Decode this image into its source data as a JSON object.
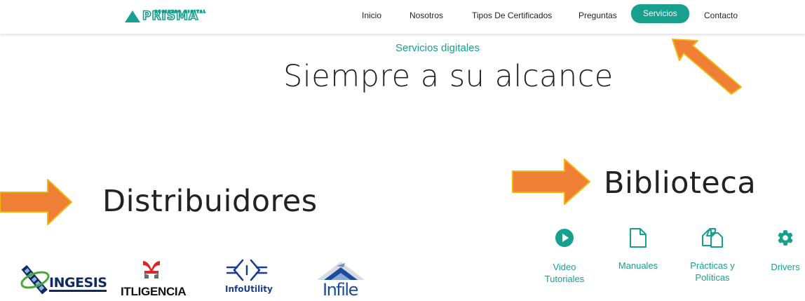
{
  "nav": {
    "logo_subtitle": "REGISTRO DIGITAL",
    "logo_text": "PRISMA",
    "items": [
      {
        "label": "Inicio"
      },
      {
        "label": "Nosotros"
      },
      {
        "label": "Tipos De Certificados"
      },
      {
        "label": "Preguntas"
      },
      {
        "label": "Servicios",
        "active": true
      },
      {
        "label": "Contacto"
      }
    ]
  },
  "hero": {
    "eyebrow": "Servicios digitales",
    "title": "Siempre a su alcance"
  },
  "distribuidores": {
    "title": "Distribuidores",
    "partners": [
      {
        "name": "INGESIS"
      },
      {
        "name": "ITLIGENCIA"
      },
      {
        "name": "InfoUtility"
      },
      {
        "name": "Infile"
      }
    ]
  },
  "biblioteca": {
    "title": "Biblioteca",
    "items": [
      {
        "label_line1": "Video",
        "label_line2": "Tutoriales",
        "icon": "play-circle-icon"
      },
      {
        "label_line1": "Manuales",
        "label_line2": "",
        "icon": "document-icon"
      },
      {
        "label_line1": "Prácticas y",
        "label_line2": "Políticas",
        "icon": "copy-documents-icon"
      },
      {
        "label_line1": "Drivers",
        "label_line2": "",
        "icon": "gear-icon"
      }
    ]
  },
  "colors": {
    "accent": "#16a08d",
    "arrow_fill": "#ee7f35",
    "arrow_stroke": "#f2b50f"
  }
}
